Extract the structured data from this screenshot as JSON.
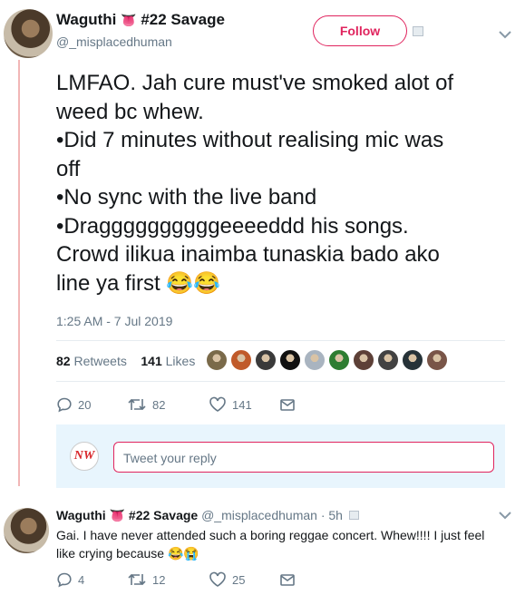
{
  "tweet": {
    "author_name": "Waguthi",
    "author_emoji": "👅",
    "author_suffix": "#22 Savage",
    "handle": "@_misplacedhuman",
    "follow_label": "Follow",
    "text_lines": [
      "LMFAO. Jah cure must've smoked alot of",
      "weed bc whew.",
      "•Did 7 minutes without realising mic was",
      "off",
      "•No sync with the live band",
      "•Draggggggggggeeeeddd his songs.",
      "Crowd ilikua inaimba tunaskia bado ako",
      "line ya first 😂😂"
    ],
    "timestamp": "1:25 AM - 7 Jul 2019",
    "retweets_count": "82",
    "retweets_label": "Retweets",
    "likes_count": "141",
    "likes_label": "Likes",
    "actions": {
      "replies": "20",
      "retweets": "82",
      "likes": "141"
    },
    "liker_colors": [
      "#7a6a4a",
      "#c05a2a",
      "#3a3a3a",
      "#111111",
      "#a9b4c0",
      "#2e7d32",
      "#5d4037",
      "#424242",
      "#263238",
      "#795548"
    ]
  },
  "reply_box": {
    "avatar_text": "NW",
    "placeholder": "Tweet your reply"
  },
  "reply": {
    "author_name": "Waguthi",
    "author_emoji": "👅",
    "author_suffix": "#22 Savage",
    "handle_time": "@_misplacedhuman · 5h",
    "text": "Gai. I have never attended such a boring reggae concert. Whew!!!! I just feel like crying because 😂😭",
    "actions": {
      "replies": "4",
      "retweets": "12",
      "likes": "25"
    }
  },
  "colors": {
    "accent": "#e0245e",
    "muted": "#657786",
    "thread": "#f2b6b6"
  }
}
